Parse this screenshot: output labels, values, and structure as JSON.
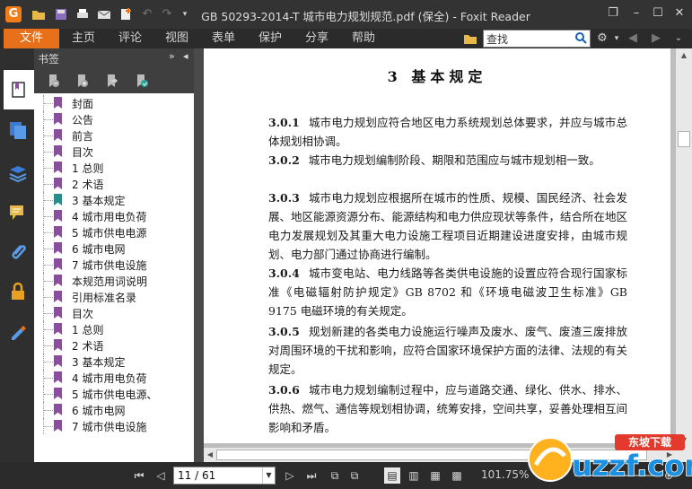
{
  "window": {
    "title": "GB 50293-2014-T 城市电力规划规范.pdf (保全) - Foxit Reader"
  },
  "menu": {
    "file": "文件",
    "items": [
      "主页",
      "评论",
      "视图",
      "表单",
      "保护",
      "分享",
      "帮助"
    ],
    "search_value": "查找"
  },
  "bookmarks": {
    "header": "书签",
    "items": [
      "封面",
      "公告",
      "前言",
      "目次",
      "1 总则",
      "2 术语",
      "3 基本规定",
      "4 城市用电负荷",
      "5 城市供电电源",
      "6 城市电网",
      "7 城市供电设施",
      "本规范用词说明",
      "引用标准名录",
      "目次",
      "1 总则",
      "2 术语",
      "3 基本规定",
      "4 城市用电负荷",
      "5 城市供电电源、",
      "6 城市电网",
      "7 城市供电设施"
    ],
    "current_index": 6
  },
  "document": {
    "chapter_title": "3 基本规定",
    "paragraphs": [
      {
        "num": "3.0.1",
        "text": "城市电力规划应符合地区电力系统规划总体要求，并应与城市总体规划相协调。"
      },
      {
        "num": "3.0.2",
        "text": "城市电力规划编制阶段、期限和范围应与城市规划相一致。"
      },
      {
        "num": "3.0.3",
        "text": "城市电力规划应根据所在城市的性质、规模、国民经济、社会发展、地区能源资源分布、能源结构和电力供应现状等条件，结合所在地区电力发展规划及其重大电力设施工程项目近期建设进度安排，由城市规划、电力部门通过协商进行编制。"
      },
      {
        "num": "3.0.4",
        "text": "城市变电站、电力线路等各类供电设施的设置应符合现行国家标准《电磁辐射防护规定》GB 8702 和《环境电磁波卫生标准》GB 9175 电磁环境的有关规定。"
      },
      {
        "num": "3.0.5",
        "text": "规划新建的各类电力设施运行噪声及废水、废气、废渣三废排放对周围环境的干扰和影响，应符合国家环境保护方面的法律、法规的有关规定。"
      },
      {
        "num": "3.0.6",
        "text": "城市电力规划编制过程中，应与道路交通、绿化、供水、排水、供热、燃气、通信等规划相协调，统筹安排，空间共享，妥善处理相互间影响和矛盾。"
      }
    ]
  },
  "status": {
    "page_indicator": "11 / 61",
    "zoom": "101.75%"
  },
  "watermark": {
    "top_text": "东坡下载",
    "logo_text": "uzzf.com"
  },
  "colors": {
    "accent": "#e8701a",
    "bookmark_flag": "#8a4f9b",
    "bookmark_current": "#2e8b8b"
  }
}
